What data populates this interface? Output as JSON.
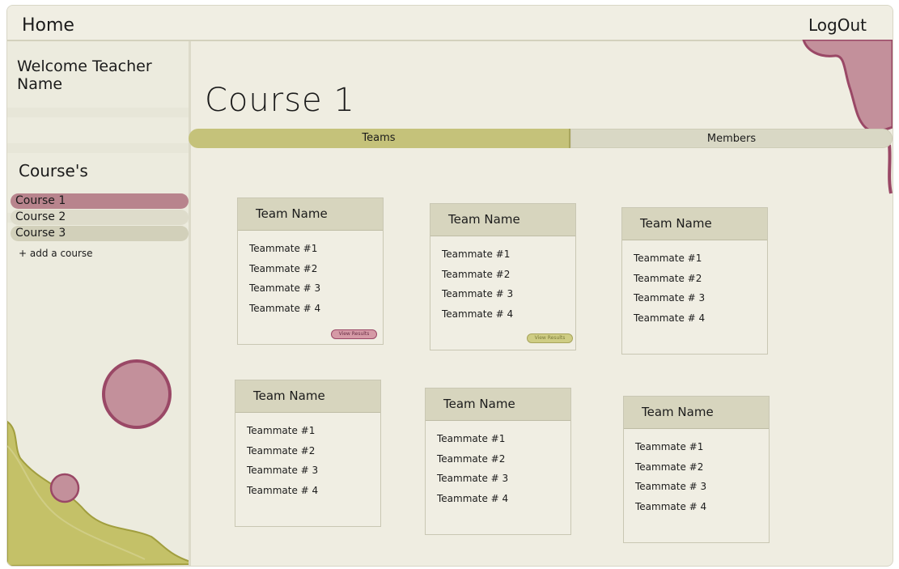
{
  "topbar": {
    "home_label": "Home",
    "logout_label": "LogOut"
  },
  "sidebar": {
    "welcome": "Welcome Teacher Name",
    "courses_heading": "Course's",
    "courses": [
      {
        "label": "Course 1",
        "selected": true
      },
      {
        "label": "Course 2",
        "selected": false
      },
      {
        "label": "Course 3",
        "selected": false
      }
    ],
    "add_course_label": "+ add a course"
  },
  "main": {
    "course_title": "Course 1",
    "tabs": [
      {
        "label": "Teams",
        "active": true
      },
      {
        "label": "Members",
        "active": false
      }
    ],
    "teams": [
      {
        "name": "Team Name",
        "members": [
          "Teammate #1",
          "Teammate #2",
          "Teammate # 3",
          "Teammate # 4"
        ],
        "button": "View Results"
      },
      {
        "name": "Team Name",
        "members": [
          "Teammate #1",
          "Teammate #2",
          "Teammate # 3",
          "Teammate # 4"
        ],
        "button": "View Results"
      },
      {
        "name": "Team Name",
        "members": [
          "Teammate #1",
          "Teammate #2",
          "Teammate # 3",
          "Teammate # 4"
        ]
      },
      {
        "name": "Team Name",
        "members": [
          "Teammate #1",
          "Teammate #2",
          "Teammate # 3",
          "Teammate # 4"
        ]
      },
      {
        "name": "Team Name",
        "members": [
          "Teammate #1",
          "Teammate #2",
          "Teammate # 3",
          "Teammate # 4"
        ]
      },
      {
        "name": "Team Name",
        "members": [
          "Teammate #1",
          "Teammate #2",
          "Teammate # 3",
          "Teammate # 4"
        ]
      }
    ]
  },
  "colors": {
    "background": "#efede1",
    "accent_olive": "#c5c27a",
    "accent_pink": "#b8848d",
    "card_header": "#d7d5be"
  }
}
